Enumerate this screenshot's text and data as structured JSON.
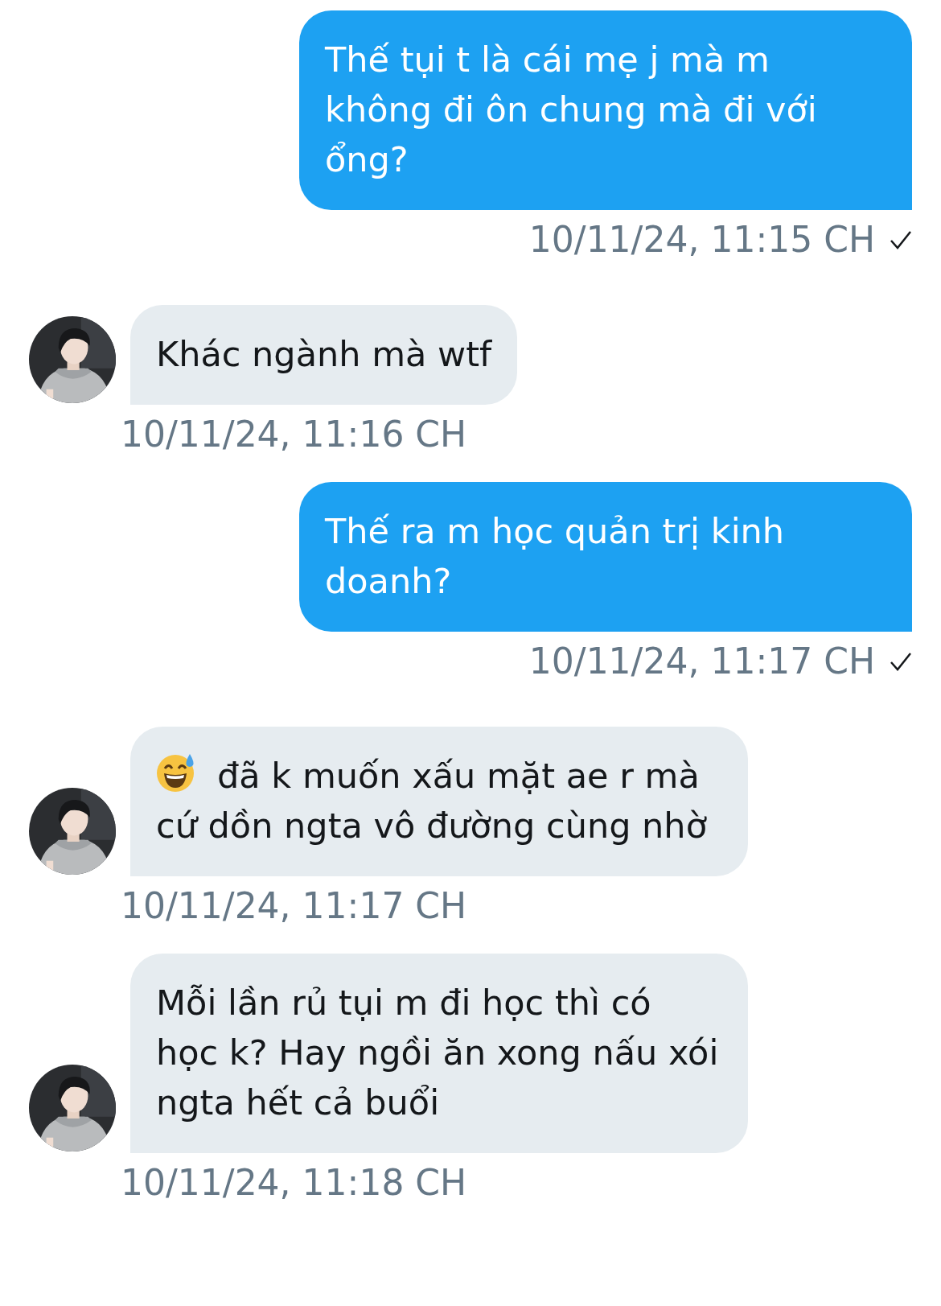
{
  "messages": [
    {
      "kind": "sent",
      "text": "Thế tụi t là cái mẹ j mà m không đi ôn chung mà đi với ổng?",
      "time": "10/11/24, 11:15 CH",
      "delivered": true,
      "emoji": false
    },
    {
      "kind": "received",
      "text": "Khác ngành mà wtf",
      "time": "10/11/24, 11:16 CH",
      "delivered": false,
      "emoji": false
    },
    {
      "kind": "sent",
      "text": "Thế ra m học quản trị kinh doanh?",
      "time": "10/11/24, 11:17 CH",
      "delivered": true,
      "emoji": false
    },
    {
      "kind": "received",
      "text": "đã k muốn xấu mặt ae r mà cứ dồn ngta vô đường cùng nhờ",
      "time": "10/11/24, 11:17 CH",
      "delivered": false,
      "emoji": true
    },
    {
      "kind": "received",
      "text": "Mỗi lần rủ tụi m đi học thì có học k? Hay ngồi ăn xong nấu xói ngta hết cả buổi",
      "time": "10/11/24, 11:18 CH",
      "delivered": false,
      "emoji": false
    }
  ]
}
